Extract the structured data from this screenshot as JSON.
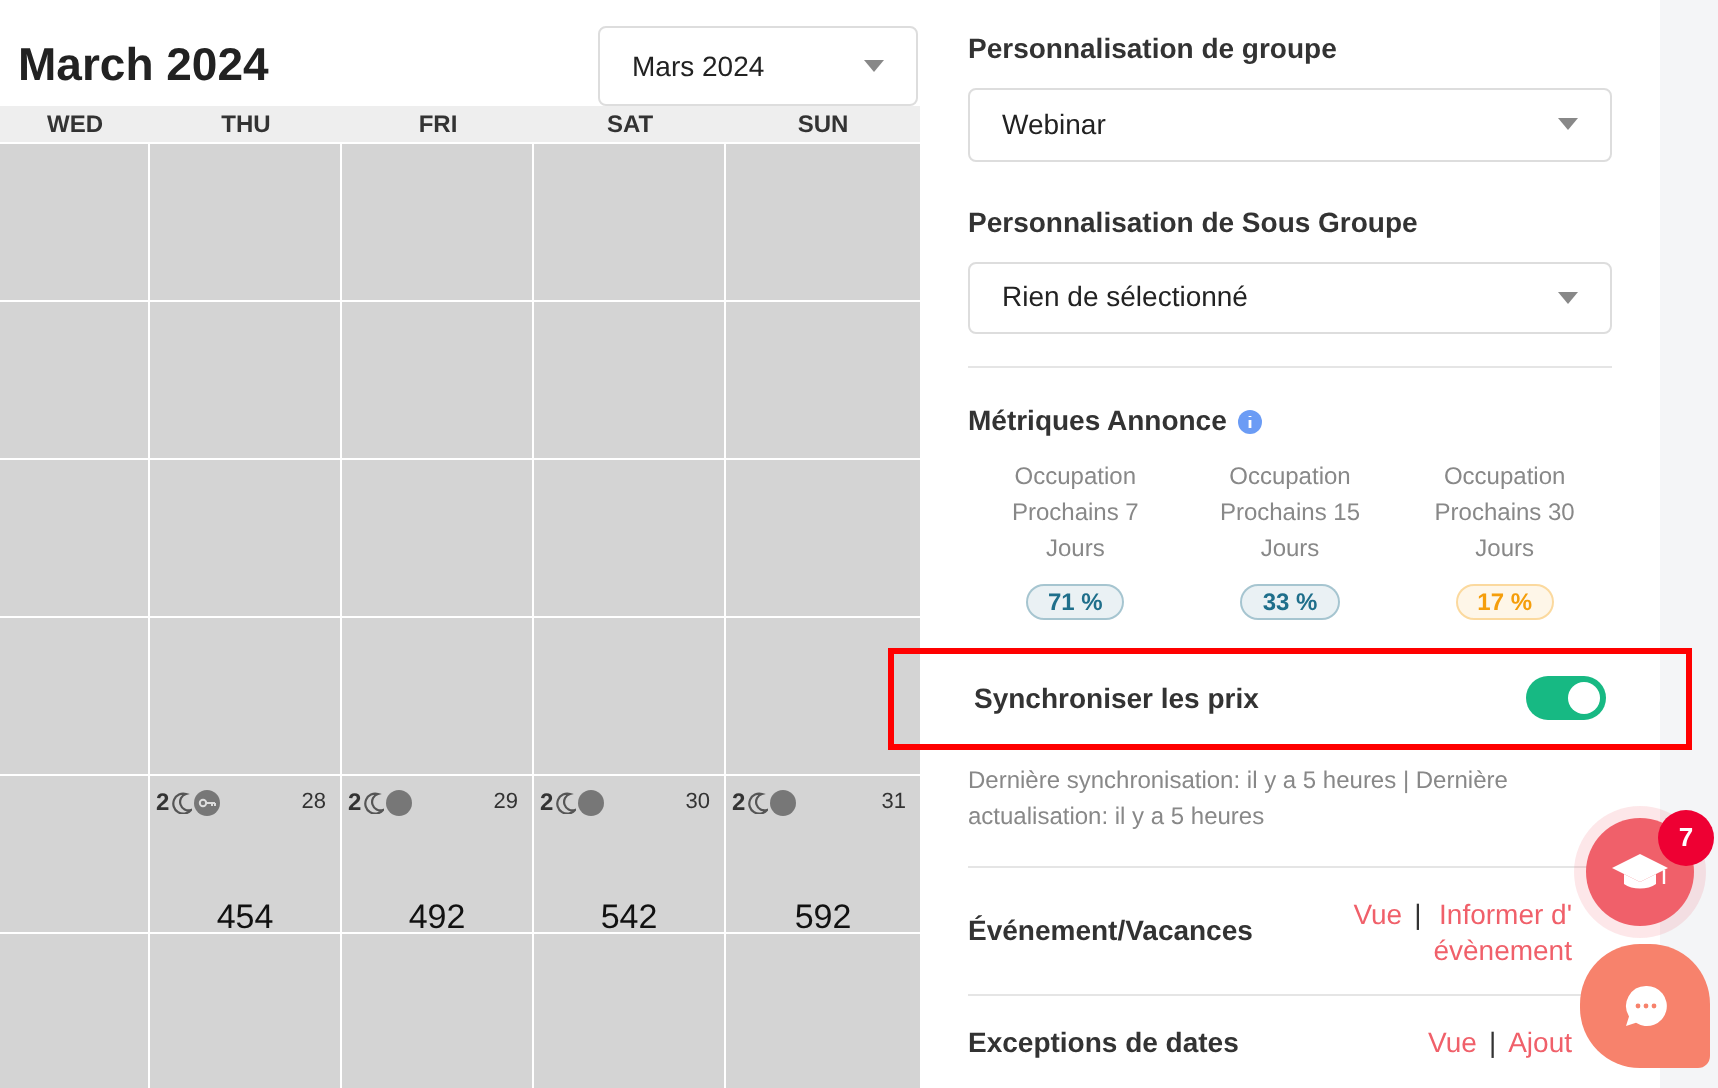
{
  "calendar": {
    "title": "March 2024",
    "month_select": {
      "value": "Mars 2024"
    },
    "weekdays": [
      "WED",
      "THU",
      "FRI",
      "SAT",
      "SUN"
    ],
    "weeks": [
      [
        {
          "kind": "empty"
        },
        {
          "kind": "empty"
        },
        {
          "kind": "empty"
        },
        {
          "kind": "empty"
        },
        {
          "kind": "empty"
        }
      ],
      [
        {
          "kind": "empty"
        },
        {
          "kind": "empty"
        },
        {
          "kind": "empty"
        },
        {
          "kind": "empty"
        },
        {
          "kind": "empty"
        }
      ],
      [
        {
          "kind": "empty"
        },
        {
          "kind": "empty"
        },
        {
          "kind": "empty"
        },
        {
          "kind": "empty"
        },
        {
          "kind": "empty"
        }
      ],
      [
        {
          "kind": "empty"
        },
        {
          "kind": "empty"
        },
        {
          "kind": "empty"
        },
        {
          "kind": "empty"
        },
        {
          "kind": "empty"
        }
      ],
      [
        {
          "kind": "empty"
        },
        {
          "kind": "day_key",
          "nights": "2",
          "day": "28",
          "price": "454"
        },
        {
          "kind": "day",
          "nights": "2",
          "day": "29",
          "price": "492"
        },
        {
          "kind": "day",
          "nights": "2",
          "day": "30",
          "price": "542"
        },
        {
          "kind": "day",
          "nights": "2",
          "day": "31",
          "price": "592"
        }
      ],
      [
        {
          "kind": "empty"
        },
        {
          "kind": "empty"
        },
        {
          "kind": "empty"
        },
        {
          "kind": "empty"
        },
        {
          "kind": "empty"
        }
      ]
    ]
  },
  "panel": {
    "group": {
      "label": "Personnalisation de groupe",
      "value": "Webinar"
    },
    "subgroup": {
      "label": "Personnalisation de Sous Groupe",
      "value": "Rien de sélectionné"
    },
    "metrics": {
      "title": "Métriques Annonce",
      "items": [
        {
          "label": "Occupation Prochains 7 Jours",
          "value": "71 %",
          "color": "#1f6f8b"
        },
        {
          "label": "Occupation Prochains 15 Jours",
          "value": "33 %",
          "color": "#1f6f8b"
        },
        {
          "label": "Occupation Prochains 30 Jours",
          "value": "17 %",
          "color": "#f59e0b"
        }
      ]
    },
    "sync": {
      "label": "Synchroniser les prix",
      "on": true,
      "highlighted": true,
      "note": "Dernière synchronisation: il y a 5 heures | Dernière actualisation: il y a 5 heures"
    },
    "rows": [
      {
        "label": "Événement/Vacances",
        "links": [
          {
            "lines": [
              "Vue"
            ]
          },
          {
            "separator": "|",
            "lines": [
              "Informer d'",
              "évènement"
            ]
          }
        ]
      },
      {
        "label": "Exceptions de dates",
        "links": [
          {
            "lines": [
              "Vue"
            ]
          },
          {
            "separator": "|",
            "lines": [
              "Ajout"
            ]
          }
        ]
      }
    ]
  },
  "floating": {
    "academy_badge": "7"
  }
}
